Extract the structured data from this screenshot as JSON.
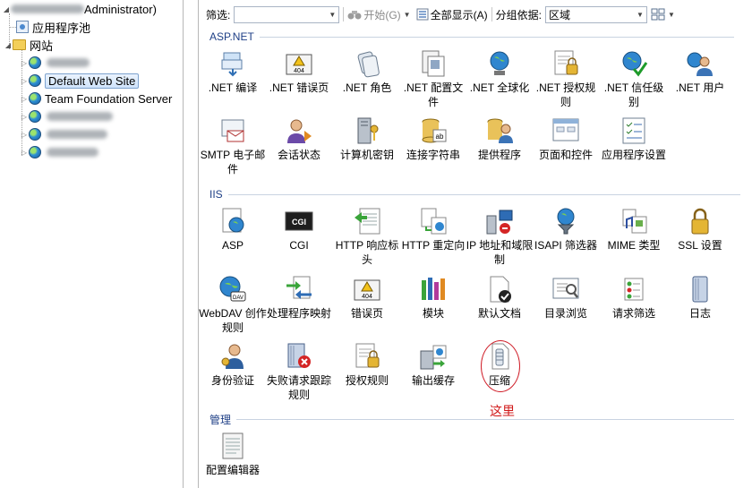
{
  "tree": {
    "root_label": "Administrator)",
    "items": [
      {
        "label": "应用程序池"
      },
      {
        "label": "网站"
      },
      {
        "label": "Default Web Site"
      },
      {
        "label": "Team Foundation Server"
      }
    ]
  },
  "toolbar": {
    "filter_label": "筛选:",
    "start_label": "开始(G)",
    "show_all_label": "全部显示(A)",
    "group_by_label": "分组依据:",
    "group_by_value": "区域"
  },
  "sections": [
    {
      "title": "ASP.NET",
      "features": [
        {
          "label": ".NET 编译",
          "icon": "dotnet-compile-icon"
        },
        {
          "label": ".NET 错误页",
          "icon": "dotnet-error-pages-icon"
        },
        {
          "label": ".NET 角色",
          "icon": "dotnet-roles-icon"
        },
        {
          "label": ".NET 配置文件",
          "icon": "dotnet-profile-icon"
        },
        {
          "label": ".NET 全球化",
          "icon": "dotnet-globalization-icon"
        },
        {
          "label": ".NET 授权规则",
          "icon": "dotnet-authorization-icon"
        },
        {
          "label": ".NET 信任级别",
          "icon": "dotnet-trust-levels-icon"
        },
        {
          "label": ".NET 用户",
          "icon": "dotnet-users-icon"
        },
        {
          "label": "SMTP 电子邮件",
          "icon": "smtp-email-icon"
        },
        {
          "label": "会话状态",
          "icon": "session-state-icon"
        },
        {
          "label": "计算机密钥",
          "icon": "machine-key-icon"
        },
        {
          "label": "连接字符串",
          "icon": "connection-strings-icon"
        },
        {
          "label": "提供程序",
          "icon": "providers-icon"
        },
        {
          "label": "页面和控件",
          "icon": "pages-controls-icon"
        },
        {
          "label": "应用程序设置",
          "icon": "app-settings-icon"
        }
      ]
    },
    {
      "title": "IIS",
      "features": [
        {
          "label": "ASP",
          "icon": "asp-icon"
        },
        {
          "label": "CGI",
          "icon": "cgi-icon"
        },
        {
          "label": "HTTP 响应标头",
          "icon": "http-response-headers-icon"
        },
        {
          "label": "HTTP 重定向",
          "icon": "http-redirect-icon"
        },
        {
          "label": "IP 地址和域限制",
          "icon": "ip-domain-restrictions-icon"
        },
        {
          "label": "ISAPI 筛选器",
          "icon": "isapi-filters-icon"
        },
        {
          "label": "MIME 类型",
          "icon": "mime-types-icon"
        },
        {
          "label": "SSL 设置",
          "icon": "ssl-settings-icon"
        },
        {
          "label": "WebDAV 创作规则",
          "icon": "webdav-icon"
        },
        {
          "label": "处理程序映射",
          "icon": "handler-mappings-icon"
        },
        {
          "label": "错误页",
          "icon": "error-pages-icon"
        },
        {
          "label": "模块",
          "icon": "modules-icon"
        },
        {
          "label": "默认文档",
          "icon": "default-document-icon"
        },
        {
          "label": "目录浏览",
          "icon": "directory-browsing-icon"
        },
        {
          "label": "请求筛选",
          "icon": "request-filtering-icon"
        },
        {
          "label": "日志",
          "icon": "logging-icon"
        },
        {
          "label": "身份验证",
          "icon": "authentication-icon"
        },
        {
          "label": "失败请求跟踪规则",
          "icon": "failed-request-tracing-icon"
        },
        {
          "label": "授权规则",
          "icon": "authorization-rules-icon"
        },
        {
          "label": "输出缓存",
          "icon": "output-caching-icon"
        },
        {
          "label": "压缩",
          "icon": "compression-icon"
        }
      ]
    },
    {
      "title": "管理",
      "features": [
        {
          "label": "配置编辑器",
          "icon": "configuration-editor-icon"
        }
      ]
    }
  ],
  "annotation": {
    "text": "这里"
  }
}
